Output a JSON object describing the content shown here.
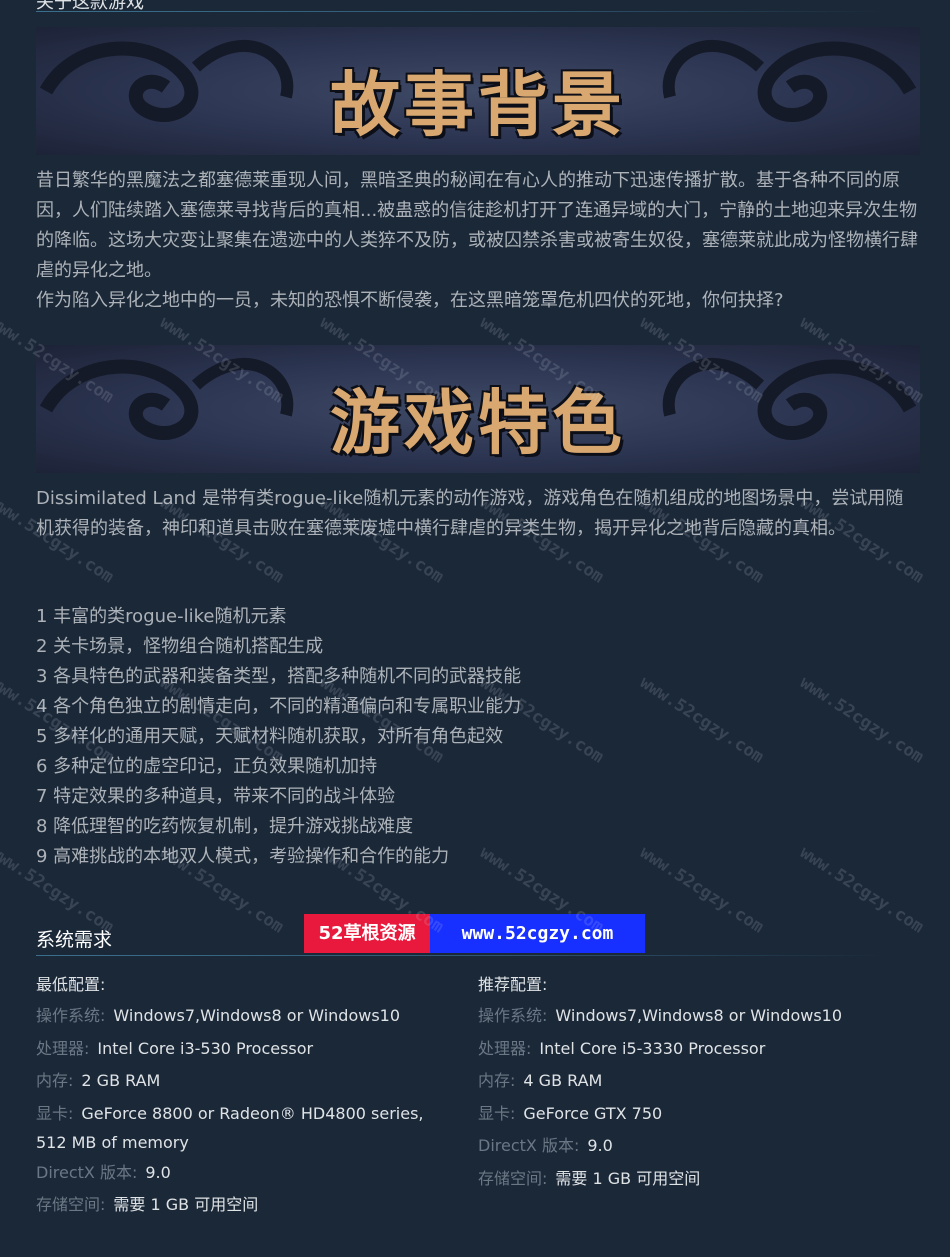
{
  "top_section": {
    "heading": "关于这款游戏"
  },
  "banners": {
    "story": "故事背景",
    "features": "游戏特色"
  },
  "story_text": {
    "p1": "昔日繁华的黑魔法之都塞德莱重现人间，黑暗圣典的秘闻在有心人的推动下迅速传播扩散。基于各种不同的原因，人们陆续踏入塞德莱寻找背后的真相...被蛊惑的信徒趁机打开了连通异域的大门，宁静的土地迎来异次生物的降临。这场大灾变让聚集在遗迹中的人类猝不及防，或被囚禁杀害或被寄生奴役，塞德莱就此成为怪物横行肆虐的异化之地。",
    "p2": "作为陷入异化之地中的一员，未知的恐惧不断侵袭，在这黑暗笼罩危机四伏的死地，你何抉择?"
  },
  "game_intro": "Dissimilated Land 是带有类rogue-like随机元素的动作游戏，游戏角色在随机组成的地图场景中，尝试用随机获得的装备，神印和道具击败在塞德莱废墟中横行肆虐的异类生物，揭开异化之地背后隐藏的真相。",
  "features": [
    "1 丰富的类rogue-like随机元素",
    "2 关卡场景，怪物组合随机搭配生成",
    "3 各具特色的武器和装备类型，搭配多种随机不同的武器技能",
    "4 各个角色独立的剧情走向，不同的精通偏向和专属职业能力",
    "5 多样化的通用天赋，天赋材料随机获取，对所有角色起效",
    "6 多种定位的虚空印记，正负效果随机加持",
    "7 特定效果的多种道具，带来不同的战斗体验",
    "8 降低理智的吃药恢复机制，提升游戏挑战难度",
    "9 高难挑战的本地双人模式，考验操作和合作的能力"
  ],
  "system_requirements": {
    "heading": "系统需求",
    "minimum": {
      "title": "最低配置:",
      "os_label": "操作系统:",
      "os": "Windows7,Windows8 or Windows10",
      "cpu_label": "处理器:",
      "cpu": "Intel Core i3-530 Processor",
      "ram_label": "内存:",
      "ram": "2 GB RAM",
      "gpu_label": "显卡:",
      "gpu_line1": "GeForce 8800 or Radeon® HD4800 series,",
      "gpu_line2": "512 MB of memory",
      "dx_label": "DirectX 版本:",
      "dx": "9.0",
      "storage_label": "存储空间:",
      "storage": "需要 1 GB 可用空间"
    },
    "recommended": {
      "title": "推荐配置:",
      "os_label": "操作系统:",
      "os": "Windows7,Windows8 or Windows10",
      "cpu_label": "处理器:",
      "cpu": "Intel Core i5-3330 Processor",
      "ram_label": "内存:",
      "ram": "4 GB RAM",
      "gpu_label": "显卡:",
      "gpu": "GeForce GTX 750",
      "dx_label": "DirectX 版本:",
      "dx": "9.0",
      "storage_label": "存储空间:",
      "storage": "需要 1 GB 可用空间"
    }
  },
  "watermark_badge": {
    "left": "52草根资源",
    "right": "www.52cgzy.com",
    "left_color": "#e8193c",
    "right_color": "#1730ff"
  },
  "watermark_text": "www.52cgzy.com",
  "colors": {
    "background": "#1b2838",
    "body_text": "#acb2b8",
    "label_text": "#6b7785",
    "banner_text": "#d8a870"
  }
}
